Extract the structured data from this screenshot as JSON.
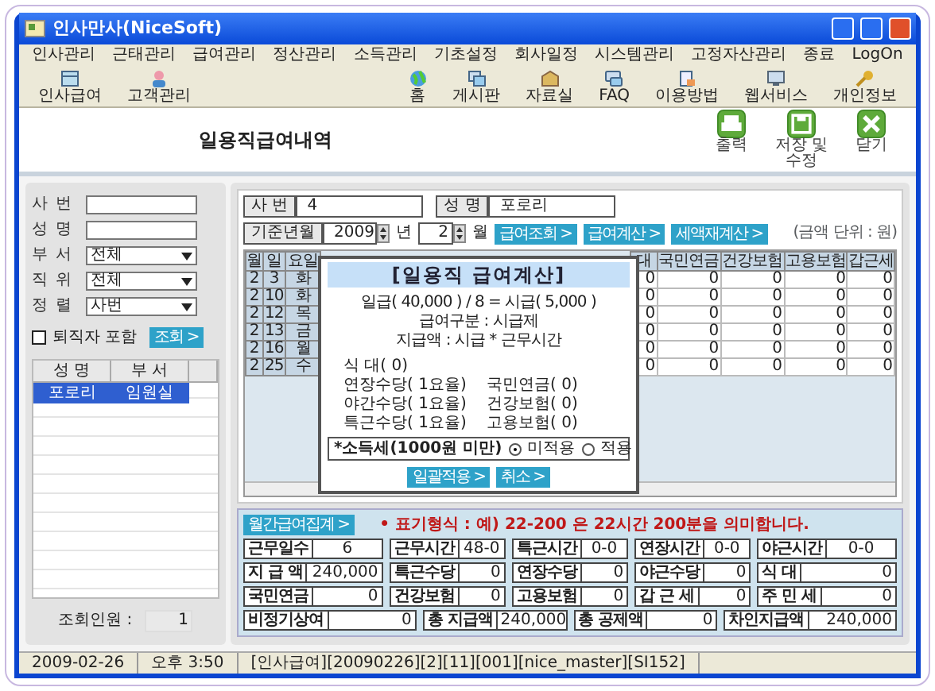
{
  "window": {
    "title": "인사만사(NiceSoft)"
  },
  "menu": [
    "인사관리",
    "근태관리",
    "급여관리",
    "정산관리",
    "소득관리",
    "기초설정",
    "회사일정",
    "시스템관리",
    "고정자산관리",
    "종료",
    "LogOn"
  ],
  "toolbar_left": [
    "인사급여",
    "고객관리"
  ],
  "toolbar_right": [
    "홈",
    "게시판",
    "자료실",
    "FAQ",
    "이용방법",
    "웹서비스",
    "개인정보"
  ],
  "page_title": "일용직급여내역",
  "actions": [
    "출력",
    "저장 및 수정",
    "닫기"
  ],
  "filters": [
    {
      "label": "사 번",
      "kind": "text"
    },
    {
      "label": "성 명",
      "kind": "text"
    },
    {
      "label": "부 서",
      "kind": "select",
      "value": "전체"
    },
    {
      "label": "직 위",
      "kind": "select",
      "value": "전체"
    },
    {
      "label": "정 렬",
      "kind": "select",
      "value": "사번"
    }
  ],
  "retired": {
    "label": "퇴직자 포함",
    "checked": false
  },
  "search_button": "조회 >",
  "employee_list": {
    "columns": [
      "성 명",
      "부 서"
    ],
    "rows": [
      {
        "cells": [
          "포로리",
          "임원실"
        ],
        "selected": true
      }
    ]
  },
  "count": {
    "label": "조회인원 :",
    "value": "1"
  },
  "employee": {
    "id_label": "사 번",
    "id": "4",
    "name_label": "성 명",
    "name": "포로리"
  },
  "period": {
    "label": "기준년월",
    "year": "2009",
    "year_unit": "년",
    "month": "2",
    "month_unit": "월",
    "buttons": [
      "급여조회 >",
      "급여계산 >",
      "세액재계산 >"
    ],
    "unit_note": "(금액 단위 : 원)"
  },
  "grid": {
    "columns": [
      "월",
      "일",
      "요일",
      "대",
      "국민연금",
      "건강보험",
      "고용보험",
      "갑근세"
    ],
    "rows": [
      [
        "2",
        "3",
        "화",
        "0",
        "0",
        "0",
        "0",
        "0"
      ],
      [
        "2",
        "10",
        "화",
        "0",
        "0",
        "0",
        "0",
        "0"
      ],
      [
        "2",
        "12",
        "목",
        "0",
        "0",
        "0",
        "0",
        "0"
      ],
      [
        "2",
        "13",
        "금",
        "0",
        "0",
        "0",
        "0",
        "0"
      ],
      [
        "2",
        "16",
        "월",
        "0",
        "0",
        "0",
        "0",
        "0"
      ],
      [
        "2",
        "25",
        "수",
        "0",
        "0",
        "0",
        "0",
        "0"
      ]
    ]
  },
  "dialog": {
    "title": "[일용직 급여계산]",
    "formula": "일급( 40,000 ) / 8 = 시급( 5,000 )",
    "lines": [
      "급여구분 : 시급제",
      "지급액 : 시급 * 근무시간"
    ],
    "rows": [
      {
        "left": "식 대( 0)"
      },
      {
        "left": "연장수당( 1요율)",
        "right": "국민연금( 0)"
      },
      {
        "left": "야간수당( 1요율)",
        "right": "건강보험( 0)"
      },
      {
        "left": "특근수당( 1요율)",
        "right": "고용보험( 0)"
      }
    ],
    "income_tax": {
      "label": "*소득세(1000원 미만)",
      "options": [
        {
          "label": "미적용",
          "selected": true
        },
        {
          "label": "적용",
          "selected": false
        }
      ]
    },
    "buttons": [
      "일괄적용 >",
      "취소 >"
    ]
  },
  "summary": {
    "button": "월간급여집계 >",
    "note": "• 표기형식 : 예) 22-200 은 22시간 200분을 의미합니다.",
    "rows": [
      {
        "kind": "time",
        "fields": [
          {
            "label": "근무일수",
            "value": "6"
          },
          {
            "label": "근무시간",
            "value": "48-0"
          },
          {
            "label": "특근시간",
            "value": "0-0"
          },
          {
            "label": "연장시간",
            "value": "0-0"
          },
          {
            "label": "야근시간",
            "value": "0-0"
          }
        ]
      },
      {
        "kind": "amount",
        "fields": [
          {
            "label": "지 급 액",
            "value": "240,000"
          },
          {
            "label": "특근수당",
            "value": "0"
          },
          {
            "label": "연장수당",
            "value": "0"
          },
          {
            "label": "야근수당",
            "value": "0"
          },
          {
            "label": "식 대",
            "value": "0"
          }
        ]
      },
      {
        "kind": "amount",
        "fields": [
          {
            "label": "국민연금",
            "value": "0"
          },
          {
            "label": "건강보험",
            "value": "0"
          },
          {
            "label": "고용보험",
            "value": "0"
          },
          {
            "label": "갑 근 세",
            "value": "0"
          },
          {
            "label": "주 민 세",
            "value": "0"
          }
        ]
      },
      {
        "kind": "amount",
        "fields": [
          {
            "label": "비정기상여",
            "value": "0"
          },
          {
            "label": "총 지급액",
            "value": "240,000"
          },
          {
            "label": "총 공제액",
            "value": "0"
          },
          {
            "label": "차인지급액",
            "value": "240,000"
          }
        ]
      }
    ]
  },
  "status_bar": [
    "2009-02-26",
    "오후 3:50",
    "[인사급여][20090226][2][11][001][nice_master][SI152]"
  ]
}
